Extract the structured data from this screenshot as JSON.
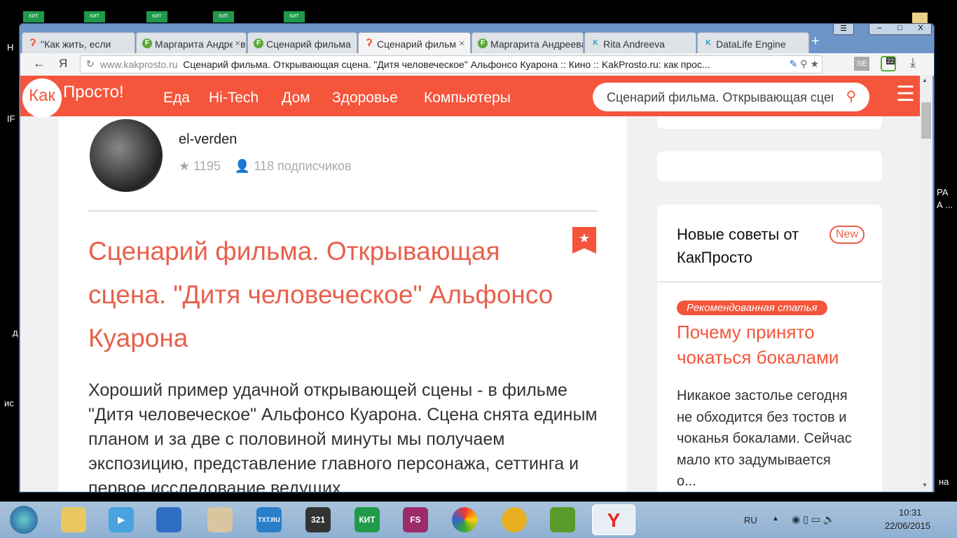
{
  "desktop": {
    "icon_label": "КИТ",
    "left_fragments": [
      "Н",
      "IF",
      "д",
      "ис"
    ],
    "right_fragments": [
      "РА",
      "А ...",
      "на"
    ]
  },
  "browser": {
    "tabs": [
      {
        "title": "\"Как жить, если",
        "favicon": "kakprosto",
        "active": false,
        "closable": false
      },
      {
        "title": "Маргарита Андреева",
        "favicon": "F",
        "active": false,
        "closable": true
      },
      {
        "title": "Сценарий фильма",
        "favicon": "F",
        "active": false,
        "closable": false
      },
      {
        "title": "Сценарий фильма",
        "favicon": "kakprosto",
        "active": true,
        "closable": true
      },
      {
        "title": "Маргарита Андреева",
        "favicon": "F",
        "active": false,
        "closable": false
      },
      {
        "title": "Rita Andreeva",
        "favicon": "kp",
        "active": false,
        "closable": false
      },
      {
        "title": "DataLife Engine",
        "favicon": "kp",
        "active": false,
        "closable": false
      }
    ],
    "new_tab": "+",
    "back": "←",
    "yandex": "Я",
    "address": {
      "domain": "www.kakprosto.ru",
      "title": "Сценарий фильма. Открывающая сцена. \"Дитя человеческое\" Альфонсо Куарона :: Кино :: KakProsto.ru: как прос..."
    },
    "ext_badge": "22"
  },
  "site": {
    "logo_kak": "Как",
    "logo_prosto": "Просто!",
    "nav": [
      "Еда",
      "Hi-Tech",
      "Дом",
      "Здоровье",
      "Компьютеры"
    ],
    "search_value": "Сценарий фильма. Открывающая сцена",
    "accent": "#f4553b"
  },
  "author": {
    "name": "el-verden",
    "rating": "1195",
    "subscribers": "118 подписчиков"
  },
  "article": {
    "title": "Сценарий фильма. Открывающая сцена. \"Дитя человеческое\" Альфонсо Куарона",
    "body": "Хороший пример удачной открывающей сцены - в фильме \"Дитя человеческое\" Альфонсо Куарона. Сцена снята единым планом и за две с половиной минуты мы получаем экспозицию, представление главного персонажа, сеттинга и первое исследование ведущих"
  },
  "sidebar": {
    "heading": "Новые советы от КакПросто",
    "badge": "New",
    "tag": "Рекомендованная статья",
    "rec_title": "Почему принято чокаться бокалами",
    "rec_text": "Никакое застолье сегодня не обходится без тостов и чоканья бокалами. Сейчас мало кто задумывается о..."
  },
  "taskbar": {
    "lang": "RU",
    "time": "10:31",
    "date": "22/06/2015",
    "apps": [
      "explorer",
      "media-player",
      "mozaik",
      "paint",
      "txt.ru",
      "321-player",
      "КИТ",
      "FS",
      "picasa",
      "webmoney",
      "evernote",
      "yandex-browser"
    ]
  }
}
